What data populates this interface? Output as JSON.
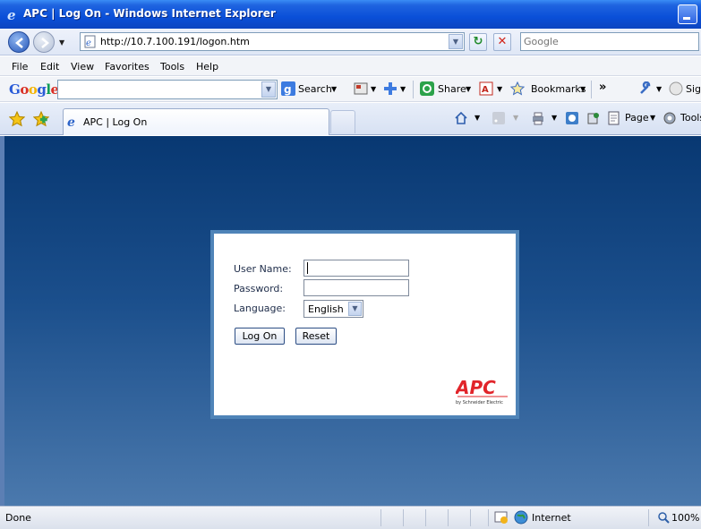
{
  "window": {
    "title": "APC | Log On - Windows Internet Explorer"
  },
  "address": {
    "url": "http://10.7.100.191/logon.htm",
    "search_placeholder": "Google"
  },
  "menu": {
    "items": [
      "File",
      "Edit",
      "View",
      "Favorites",
      "Tools",
      "Help"
    ]
  },
  "google_toolbar": {
    "logo": "Google",
    "search_label": "Search",
    "share_label": "Share",
    "bookmarks_label": "Bookmarks",
    "more_label": "»",
    "sign_label": "Sig"
  },
  "tabs": {
    "active_title": "APC | Log On"
  },
  "command_bar": {
    "page_label": "Page",
    "tools_label": "Tools"
  },
  "login": {
    "username_label": "User Name:",
    "password_label": "Password:",
    "language_label": "Language:",
    "language_value": "English",
    "logon_button": "Log On",
    "reset_button": "Reset",
    "logo_text": "APC",
    "logo_sub": "by Schneider Electric"
  },
  "status": {
    "text": "Done",
    "zone": "Internet",
    "zoom": "100%"
  },
  "colors": {
    "titlebar": "#0a4fd8",
    "content_top": "#083872",
    "content_bottom": "#4b79ad",
    "apc_red": "#e1242a"
  }
}
